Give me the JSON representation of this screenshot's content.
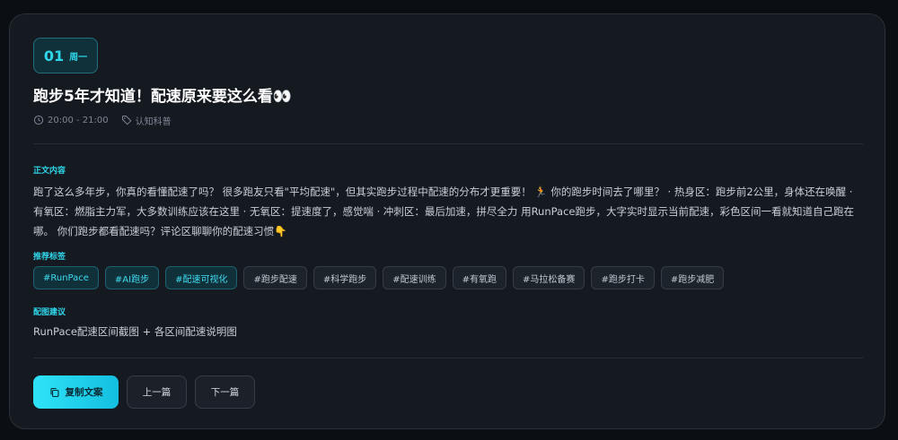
{
  "day": {
    "number": "01",
    "name": "周一"
  },
  "title": "跑步5年才知道！配速原来要这么看👀",
  "meta": {
    "time": "20:00 - 21:00",
    "category": "认知科普"
  },
  "sections": {
    "body_label": "正文内容",
    "tags_label": "推荐标签",
    "image_label": "配图建议"
  },
  "body": "跑了这么多年步，你真的看懂配速了吗？ 很多跑友只看\"平均配速\"，但其实跑步过程中配速的分布才更重要！ 🏃 你的跑步时间去了哪里？ · 热身区：跑步前2公里，身体还在唤醒 · 有氧区：燃脂主力军，大多数训练应该在这里 · 无氧区：提速度了，感觉喘 · 冲刺区：最后加速，拼尽全力 用RunPace跑步，大字实时显示当前配速，彩色区间一看就知道自己跑在哪。 你们跑步都看配速吗？评论区聊聊你的配速习惯👇",
  "tags": [
    {
      "label": "#RunPace",
      "highlight": true
    },
    {
      "label": "#AI跑步",
      "highlight": true
    },
    {
      "label": "#配速可视化",
      "highlight": true
    },
    {
      "label": "#跑步配速",
      "highlight": false
    },
    {
      "label": "#科学跑步",
      "highlight": false
    },
    {
      "label": "#配速训练",
      "highlight": false
    },
    {
      "label": "#有氧跑",
      "highlight": false
    },
    {
      "label": "#马拉松备赛",
      "highlight": false
    },
    {
      "label": "#跑步打卡",
      "highlight": false
    },
    {
      "label": "#跑步减肥",
      "highlight": false
    }
  ],
  "image_suggestion": "RunPace配速区间截图 + 各区间配速说明图",
  "buttons": {
    "copy": "复制文案",
    "prev": "上一篇",
    "next": "下一篇"
  },
  "colors": {
    "accent": "#2fd6ea",
    "background": "#0b0e12",
    "card": "#151a21"
  },
  "icons": {
    "time": "clock-icon",
    "category": "tag-icon",
    "copy": "copy-icon"
  }
}
